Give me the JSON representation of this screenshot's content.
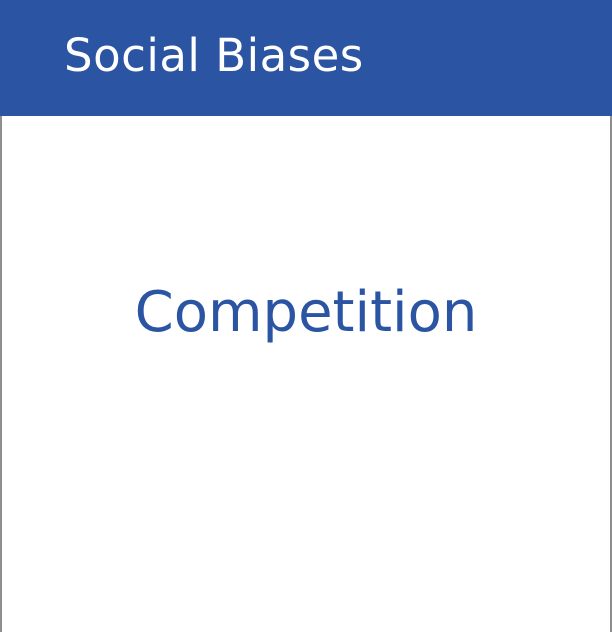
{
  "header": {
    "title": "Social Biases"
  },
  "card": {
    "term": "Competition"
  },
  "colors": {
    "brand": "#2b54a2",
    "border": "#8e8e8e"
  }
}
